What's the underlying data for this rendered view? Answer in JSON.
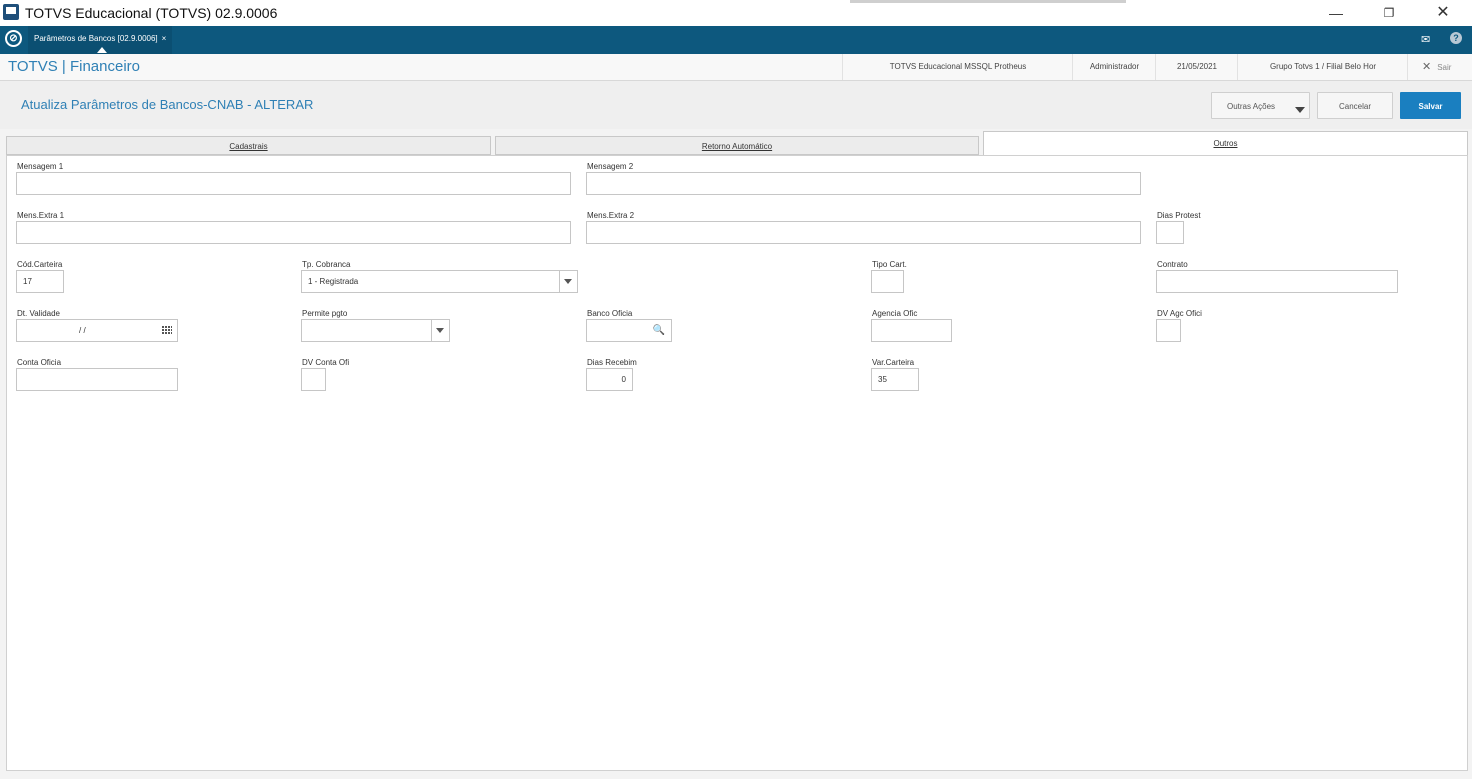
{
  "window": {
    "title": "TOTVS Educacional (TOTVS) 02.9.0006",
    "min_icon": "—",
    "max_icon": "❐",
    "close_icon": "✕"
  },
  "tabbar": {
    "logo_glyph": "⊘",
    "active_tab": "Parâmetros de Bancos [02.9.0006]",
    "tab_close": "×",
    "mail_icon": "✉",
    "help_icon": "?"
  },
  "module": {
    "title": "TOTVS | Financeiro",
    "environment": "TOTVS Educacional MSSQL Protheus",
    "user": "Administrador",
    "date": "21/05/2021",
    "branch": "Grupo Totvs 1 / Filial Belo Hor",
    "exit_icon": "✕",
    "exit_label": "Sair"
  },
  "page": {
    "title": "Atualiza Parâmetros de Bancos-CNAB - ALTERAR",
    "more_actions": "Outras Ações",
    "cancel": "Cancelar",
    "save": "Salvar"
  },
  "tabs": {
    "cadastrais": "Cadastrais",
    "retorno": "Retorno Automático",
    "outros": "Outros"
  },
  "form": {
    "mensagem1": {
      "label": "Mensagem 1",
      "value": ""
    },
    "mensagem2": {
      "label": "Mensagem 2",
      "value": ""
    },
    "mens_extra1": {
      "label": "Mens.Extra 1",
      "value": ""
    },
    "mens_extra2": {
      "label": "Mens.Extra 2",
      "value": ""
    },
    "dias_protest": {
      "label": "Dias Protest",
      "value": ""
    },
    "cod_carteira": {
      "label": "Cód.Carteira",
      "value": "17"
    },
    "tp_cobranca": {
      "label": "Tp. Cobranca",
      "value": "1 - Registrada"
    },
    "tipo_cart": {
      "label": "Tipo Cart.",
      "value": ""
    },
    "contrato": {
      "label": "Contrato",
      "value": ""
    },
    "dt_validade": {
      "label": "Dt. Validade",
      "value": "/ /"
    },
    "permite_pgto": {
      "label": "Permite pgto",
      "value": ""
    },
    "banco_oficia": {
      "label": "Banco Oficia",
      "value": ""
    },
    "agencia_ofic": {
      "label": "Agencia Ofic",
      "value": ""
    },
    "dv_agc_ofici": {
      "label": "DV Agc Ofici",
      "value": ""
    },
    "conta_oficia": {
      "label": "Conta Oficia",
      "value": ""
    },
    "dv_conta_ofi": {
      "label": "DV Conta Ofi",
      "value": ""
    },
    "dias_recebim": {
      "label": "Dias Recebim",
      "value": "0"
    },
    "var_carteira": {
      "label": "Var.Carteira",
      "value": "35"
    },
    "search_glyph": "🔍"
  }
}
